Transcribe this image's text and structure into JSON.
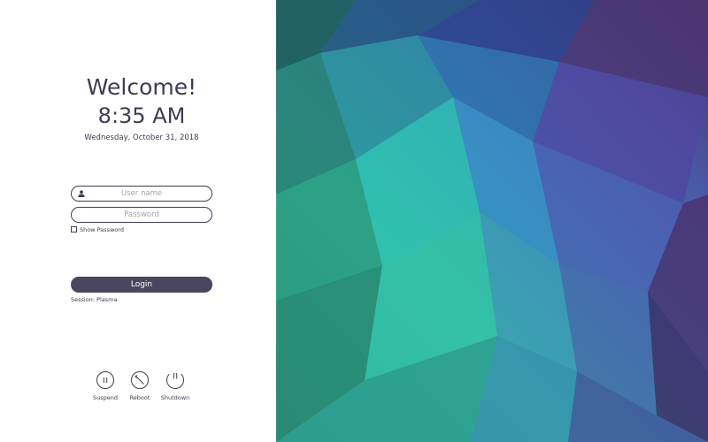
{
  "greeting": {
    "welcome": "Welcome!",
    "time": "8:35 AM",
    "date": "Wednesday, October 31, 2018"
  },
  "login": {
    "username_placeholder": "User name",
    "username_value": "",
    "password_placeholder": "Password",
    "password_value": "",
    "show_password_label": "Show Password",
    "show_password_checked": false,
    "login_button_label": "Login",
    "session_label": "Session: Plasma"
  },
  "power": {
    "suspend_label": "Suspend",
    "reboot_label": "Reboot",
    "shutdown_label": "Shutdown"
  },
  "icons": {
    "user": "user-icon",
    "suspend": "pause-icon",
    "reboot": "reboot-icon",
    "shutdown": "power-icon"
  },
  "colors": {
    "text": "#3f3b54",
    "button": "#4a4660",
    "wallpaper_teal": "#2ebfa5",
    "wallpaper_blue": "#3c5fae",
    "wallpaper_purple": "#4b2f66"
  }
}
